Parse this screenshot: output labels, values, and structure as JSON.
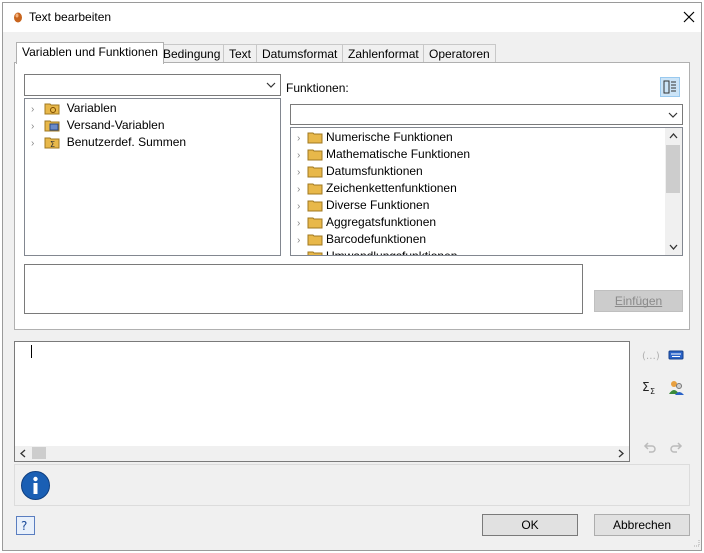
{
  "window": {
    "title": "Text bearbeiten"
  },
  "tabs": [
    {
      "label": "Variablen und Funktionen",
      "active": true
    },
    {
      "label": "Bedingung"
    },
    {
      "label": "Text"
    },
    {
      "label": "Datumsformat"
    },
    {
      "label": "Zahlenformat"
    },
    {
      "label": "Operatoren"
    }
  ],
  "left_tree": [
    {
      "label": "Variablen",
      "icon": "variables-folder-icon"
    },
    {
      "label": "Versand-Variablen",
      "icon": "shipping-variables-icon"
    },
    {
      "label": "Benutzerdef. Summen",
      "icon": "custom-sums-icon"
    }
  ],
  "functions": {
    "label": "Funktionen:",
    "items": [
      "Numerische Funktionen",
      "Mathematische Funktionen",
      "Datumsfunktionen",
      "Zeichenkettenfunktionen",
      "Diverse Funktionen",
      "Aggregatsfunktionen",
      "Barcodefunktionen",
      "Umwandlungsfunktionen"
    ]
  },
  "buttons": {
    "insert": "Einfügen",
    "ok": "OK",
    "cancel": "Abbrechen"
  },
  "colors": {
    "folder": "#e8b84a",
    "accent": "#1a5fb4"
  }
}
